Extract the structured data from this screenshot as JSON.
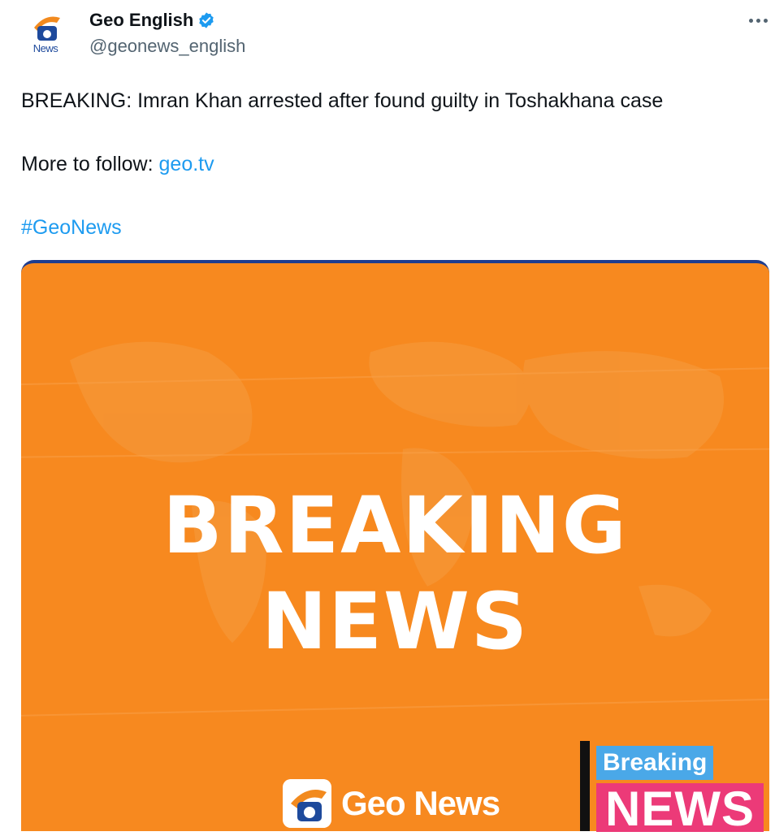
{
  "author": {
    "display_name": "Geo English",
    "handle": "@geonews_english",
    "avatar_label": "News"
  },
  "tweet": {
    "line1": "BREAKING: Imran Khan arrested after found guilty in Toshakhana case",
    "line2_prefix": "More to follow: ",
    "line2_link": "geo.tv",
    "hashtag": "#GeoNews"
  },
  "media": {
    "headline_1": "BREAKING",
    "headline_2": "NEWS",
    "brand_text": "Geo News"
  },
  "badge": {
    "top": "Breaking",
    "bottom": "NEWS"
  },
  "icons": {
    "verified": "verified-badge-icon",
    "more": "more-options-icon"
  },
  "colors": {
    "accent": "#1d9bf0",
    "media_orange": "#f7891f",
    "media_border": "#1e3d8f",
    "badge_blue": "#4aa8e8",
    "badge_pink": "#ec3a78"
  }
}
